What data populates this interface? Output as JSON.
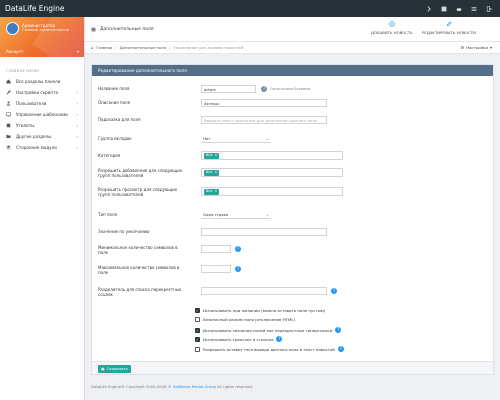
{
  "app": {
    "brand": "DataLife Engine"
  },
  "user": {
    "name": "Администратор",
    "role": "Главный администратор",
    "login": "Аккаунт"
  },
  "sidebar": {
    "section_label": "ГЛАВНОЕ МЕНЮ",
    "items": [
      {
        "label": "Все разделы панели",
        "icon": "home-icon",
        "has_children": false
      },
      {
        "label": "Настройки скрипта",
        "icon": "wrench-icon",
        "has_children": true
      },
      {
        "label": "Пользователи",
        "icon": "user-icon",
        "has_children": true
      },
      {
        "label": "Управление шаблонами",
        "icon": "monitor-icon",
        "has_children": true
      },
      {
        "label": "Утилиты",
        "icon": "puzzle-icon",
        "has_children": true
      },
      {
        "label": "Другие разделы",
        "icon": "folder-icon",
        "has_children": true
      },
      {
        "label": "Сторонние модули",
        "icon": "layers-icon",
        "has_children": true
      }
    ]
  },
  "header": {
    "title": "Дополнительные поля",
    "buttons": [
      {
        "label": "ДОБАВИТЬ НОВОСТЬ",
        "icon": "plus-circle-icon"
      },
      {
        "label": "РЕДАКТИРОВАТЬ НОВОСТИ",
        "icon": "edit-icon"
      }
    ]
  },
  "breadcrumb": {
    "items": [
      "Главная",
      "Дополнительные поля",
      "Управление доп.полями новостей"
    ],
    "settings_label": "Настройки"
  },
  "form": {
    "title": "Редактирование дополнительного поля",
    "fields": {
      "name_label": "Название поля",
      "name_value": "actors",
      "name_hint": "Латинскими буквами",
      "desc_label": "Описание поля",
      "desc_value": "Актеры",
      "hint_label": "Подсказка для поля",
      "hint_placeholder": "Введите текст подсказки для заполнения данного поля",
      "group_label": "Группа вкладок",
      "group_value": "Нет",
      "category_label": "Категория",
      "category_tag": "Все",
      "add_groups_label": "Разрешить добавление для следующих групп пользователей",
      "add_groups_tag": "Все",
      "view_groups_label": "Разрешить просмотр для следующих групп пользователей",
      "view_groups_tag": "Все",
      "type_label": "Тип поля",
      "type_value": "Одна строка",
      "default_label": "Значение по умолчанию",
      "min_label": "Минимальное количество символов в поле",
      "max_label": "Максимальное количество символов в поле",
      "separator_label": "Разделитель для списка перекрестных ссылок"
    },
    "checkboxes": [
      {
        "label": "Использовать при желании (можно оставить поле пустым)",
        "checked": true
      },
      {
        "label": "Безопасный режим поля (отключение HTML)",
        "checked": false
      },
      {
        "label": "Использовать значения полей как перекрестные гиперссылки",
        "checked": true
      },
      {
        "label": "Использовать транслит в ссылках",
        "checked": true
      },
      {
        "label": "Разрешить вставку тега вывода данного поля в текст новостей",
        "checked": false
      }
    ],
    "save_label": "Сохранить"
  },
  "footer": {
    "prefix": "DataLife Engine® Copyright 2004-2018 ©",
    "link": "SoftNews Media Group",
    "suffix": "All rights reserved."
  },
  "colors": {
    "navbar": "#263238",
    "panel_header": "#546e8a",
    "accent": "#2196f3",
    "tag": "#26a69a"
  }
}
